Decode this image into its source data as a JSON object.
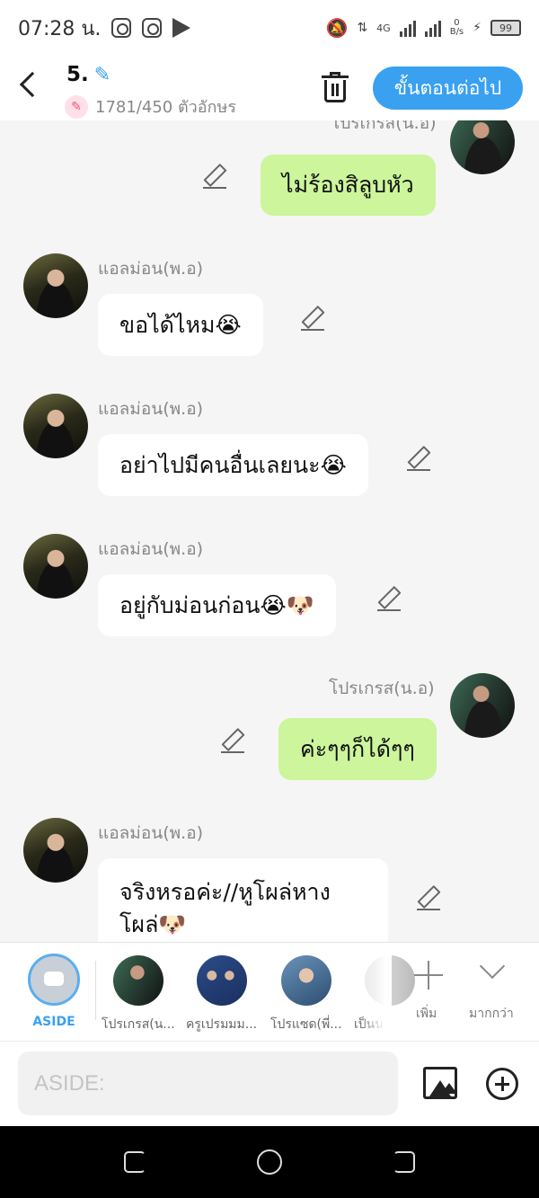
{
  "status_bar": {
    "time": "07:28 น.",
    "network": "4G",
    "speed_value": "0",
    "speed_unit": "B/s",
    "battery": "99"
  },
  "header": {
    "chapter": "5.",
    "char_count": "1781/450 ตัวอักษร",
    "next_label": "ขั้นตอนต่อไป"
  },
  "messages": [
    {
      "side": "right",
      "speaker": "โปรเกรส(น.อ)",
      "text": "ไม่ร้องสิลูบหัว"
    },
    {
      "side": "left",
      "speaker": "แอลม่อน(พ.อ)",
      "text": "ขอได้ไหม😭"
    },
    {
      "side": "left",
      "speaker": "แอลม่อน(พ.อ)",
      "text": "อย่าไปมีคนอื่นเลยนะ😭"
    },
    {
      "side": "left",
      "speaker": "แอลม่อน(พ.อ)",
      "text": "อยู่กับม่อนก่อน😭🐶"
    },
    {
      "side": "right",
      "speaker": "โปรเกรส(น.อ)",
      "text": "ค่ะๆๆก็ได้ๆๆ"
    },
    {
      "side": "left",
      "speaker": "แอลม่อน(พ.อ)",
      "text": "จริงหรอค่ะ//หูโผล่หางโผล่🐶"
    }
  ],
  "characters": {
    "aside_label": "ASIDE",
    "items": [
      "โปรเกรส(น...",
      "ครูเปรมมม...",
      "โปรแซด(พี่...",
      "เป็นน"
    ],
    "add_label": "เพิ่ม",
    "more_label": "มากกว่า"
  },
  "input": {
    "placeholder": "ASIDE:"
  },
  "colors": {
    "accent": "#3aa0f0",
    "right_bubble": "#ccf59c",
    "left_bubble": "#ffffff",
    "background": "#f5f5f5"
  }
}
